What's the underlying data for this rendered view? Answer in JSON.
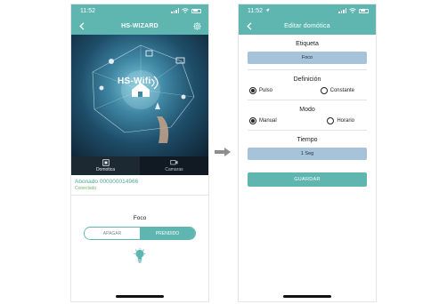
{
  "left_screen": {
    "status_time": "11:52",
    "title": "HS-WIZARD",
    "hero_brand": "HS-Wifi",
    "tabs": [
      {
        "label": "Domotica",
        "icon": "domotica-icon"
      },
      {
        "label": "Camaras",
        "icon": "camera-icon"
      }
    ],
    "account_id": "Abonado 000000014966",
    "account_status": "Conectado",
    "device_name": "Foco",
    "toggle_off": "APAGAR",
    "toggle_on": "PRENDIDO",
    "toggle_state": "PRENDIDO"
  },
  "right_screen": {
    "status_time": "11:52",
    "title": "Editar domótica",
    "label_section": "Etiqueta",
    "label_value": "Foco",
    "definition_section": "Definición",
    "definition_options": [
      "Pulso",
      "Constante"
    ],
    "definition_selected": "Pulso",
    "mode_section": "Modo",
    "mode_options": [
      "Manual",
      "Horario"
    ],
    "mode_selected": "Manual",
    "time_section": "Tiempo",
    "time_value": "1 Seg",
    "save_label": "GUARDAR"
  },
  "colors": {
    "accent": "#5fb6b0",
    "value_box": "#a6c3da",
    "account_text": "#4fa6a0",
    "connected": "#6fb66f",
    "tab_bar": "#111a22"
  }
}
